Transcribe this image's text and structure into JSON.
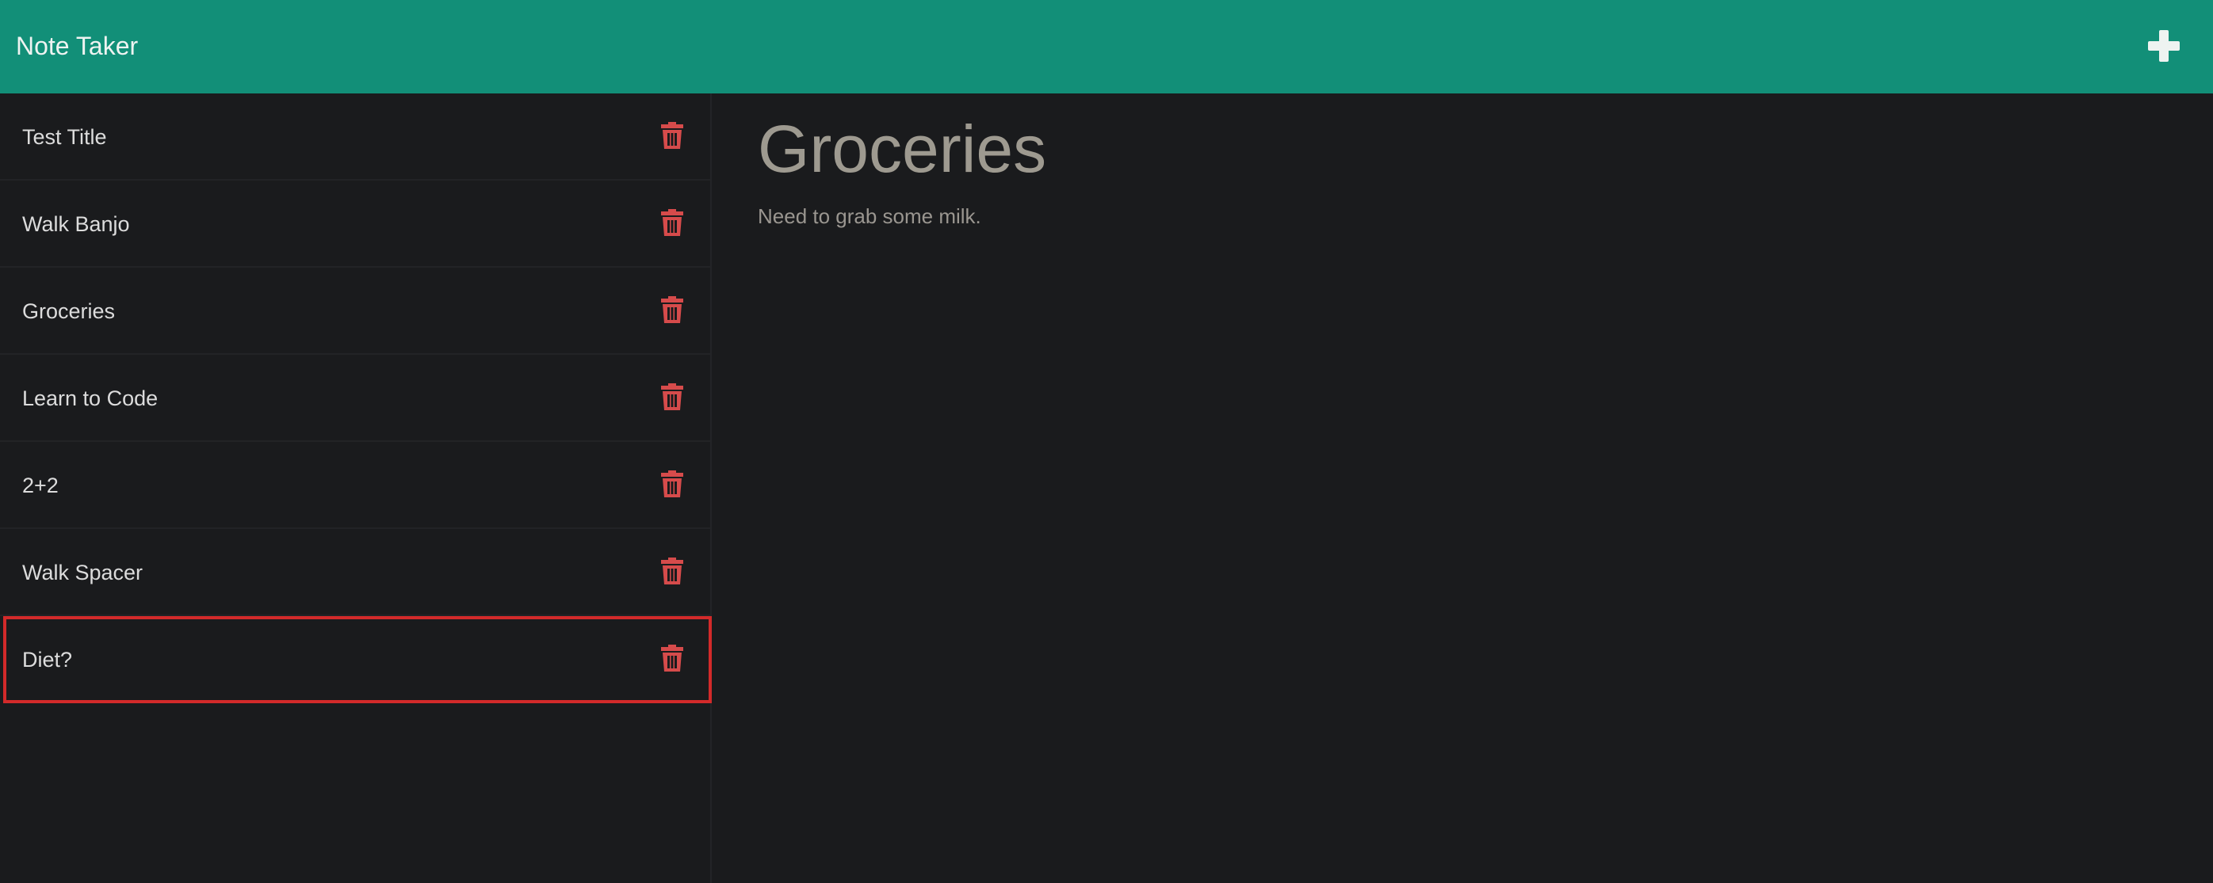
{
  "navbar": {
    "brand": "Note Taker",
    "add_icon": "plus-icon",
    "bg_color": "#128f78"
  },
  "notes": [
    {
      "title": "Test Title"
    },
    {
      "title": "Walk Banjo"
    },
    {
      "title": "Groceries"
    },
    {
      "title": "Learn to Code"
    },
    {
      "title": "2+2"
    },
    {
      "title": "Walk Spacer"
    },
    {
      "title": "Diet?"
    }
  ],
  "delete_icon": "trash-icon",
  "delete_color": "#d64b4b",
  "highlight_color": "#d32a2a",
  "active_note": {
    "title": "Groceries",
    "text": "Need to grab some milk."
  }
}
